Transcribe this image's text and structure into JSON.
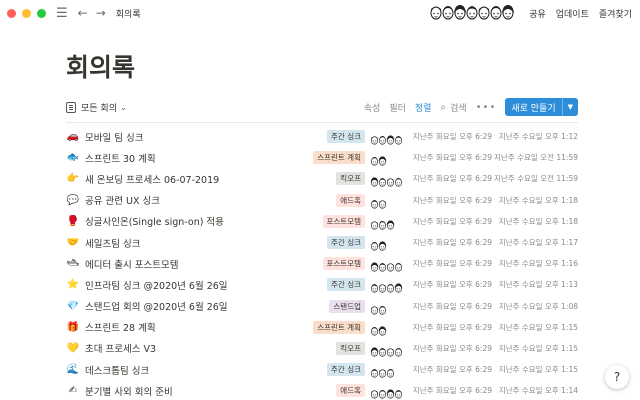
{
  "titlebar": {
    "breadcrumb": "회의록",
    "links": [
      "공유",
      "업데이트",
      "즐겨찾기"
    ],
    "collaborator_count": 7
  },
  "page": {
    "title": "회의록"
  },
  "toolbar": {
    "view_label": "모든 회의",
    "properties": "속성",
    "filter": "필터",
    "sort": "정렬",
    "search": "검색",
    "new_button": "새로 만들기"
  },
  "colors": {
    "accent": "#2e8dd8",
    "tag_weekly": "#d3e5ef",
    "tag_sprint": "#fadec9",
    "tag_kickoff": "#e3e2e0",
    "tag_ad_hoc": "#ffe2dd",
    "tag_retro": "#ffe2dd",
    "tag_standup": "#e8deee"
  },
  "rows": [
    {
      "emoji": "🚗",
      "title": "모바일 팀 싱크",
      "tag": "주간 싱크",
      "tag_color": "#d3e5ef",
      "avatars": 4,
      "created": "지난주 화요일 오후 6:29",
      "edited": "지난주 수요일 오후 1:12"
    },
    {
      "emoji": "🐟",
      "title": "스프린트 30 계획",
      "tag": "스프린트 계획",
      "tag_color": "#fadec9",
      "avatars": 2,
      "created": "지난주 화요일 오후 6:29",
      "edited": "지난주 수요일 오전 11:59"
    },
    {
      "emoji": "👉",
      "title": "새 온보딩 프로세스 06-07-2019",
      "tag": "킥오프",
      "tag_color": "#e3e2e0",
      "avatars": 4,
      "created": "지난주 화요일 오후 6:29",
      "edited": "지난주 수요일 오전 11:59"
    },
    {
      "emoji": "💬",
      "title": "공유 관련 UX 싱크",
      "tag": "애드혹",
      "tag_color": "#ffe2dd",
      "avatars": 2,
      "created": "지난주 화요일 오후 6:29",
      "edited": "지난주 수요일 오후 1:18"
    },
    {
      "emoji": "🥊",
      "title": "싱글사인온(Single sign-on) 적용",
      "tag": "포스트모템",
      "tag_color": "#ffe2dd",
      "avatars": 3,
      "created": "지난주 화요일 오후 6:29",
      "edited": "지난주 수요일 오후 1:18"
    },
    {
      "emoji": "🤝",
      "title": "세일즈팀 싱크",
      "tag": "주간 싱크",
      "tag_color": "#d3e5ef",
      "avatars": 2,
      "created": "지난주 화요일 오후 6:29",
      "edited": "지난주 수요일 오후 1:17"
    },
    {
      "emoji": "🛥",
      "title": "에디터 출시 포스트모템",
      "tag": "포스트모템",
      "tag_color": "#ffe2dd",
      "avatars": 4,
      "created": "지난주 화요일 오후 6:29",
      "edited": "지난주 수요일 오후 1:16"
    },
    {
      "emoji": "⭐",
      "title": "인프라팀 싱크 @2020년 6월 26일",
      "tag": "주간 싱크",
      "tag_color": "#d3e5ef",
      "avatars": 4,
      "created": "지난주 화요일 오후 6:29",
      "edited": "지난주 수요일 오후 1:13"
    },
    {
      "emoji": "💎",
      "title": "스탠드업 회의 @2020년 6월 26일",
      "tag": "스탠드업",
      "tag_color": "#e8deee",
      "avatars": 2,
      "created": "지난주 화요일 오후 6:29",
      "edited": "지난주 수요일 오후 1:08"
    },
    {
      "emoji": "🎁",
      "title": "스프린트 28 계획",
      "tag": "스프린트 계획",
      "tag_color": "#fadec9",
      "avatars": 2,
      "created": "지난주 화요일 오후 6:29",
      "edited": "지난주 수요일 오후 1:15"
    },
    {
      "emoji": "💛",
      "title": "초대 프로세스 V3",
      "tag": "킥오프",
      "tag_color": "#e3e2e0",
      "avatars": 4,
      "created": "지난주 화요일 오후 6:29",
      "edited": "지난주 수요일 오후 1:15"
    },
    {
      "emoji": "🌊",
      "title": "데스크톱팀 싱크",
      "tag": "주간 싱크",
      "tag_color": "#d3e5ef",
      "avatars": 3,
      "created": "지난주 화요일 오후 6:29",
      "edited": "지난주 수요일 오후 1:15"
    },
    {
      "emoji": "✍",
      "title": "분기별 사외 회의 준비",
      "tag": "애드혹",
      "tag_color": "#ffe2dd",
      "avatars": 4,
      "created": "지난주 화요일 오후 6:29",
      "edited": "지난주 수요일 오후 1:14"
    }
  ],
  "help": {
    "label": "?"
  }
}
